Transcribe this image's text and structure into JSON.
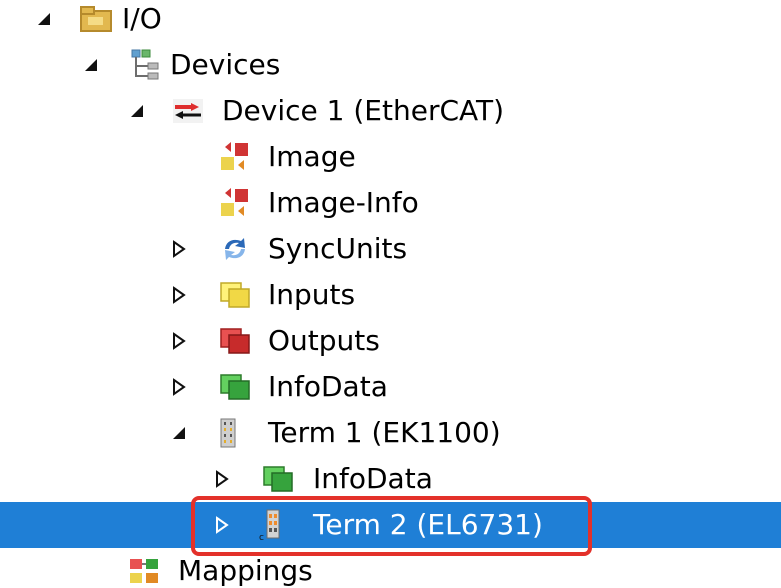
{
  "tree": {
    "io": {
      "label": "I/O"
    },
    "devices": {
      "label": "Devices"
    },
    "device1": {
      "label": "Device 1 (EtherCAT)"
    },
    "image": {
      "label": "Image"
    },
    "imageInfo": {
      "label": "Image-Info"
    },
    "syncUnits": {
      "label": "SyncUnits"
    },
    "inputs": {
      "label": "Inputs"
    },
    "outputs": {
      "label": "Outputs"
    },
    "infoData": {
      "label": "InfoData"
    },
    "term1": {
      "label": "Term 1 (EK1100)"
    },
    "term1InfoData": {
      "label": "InfoData"
    },
    "term2": {
      "label": "Term 2 (EL6731)"
    },
    "mappings": {
      "label": "Mappings"
    }
  },
  "colors": {
    "selection": "#1f7fd6",
    "highlight": "#e3312a",
    "inputs_icon": "#e5d84b",
    "outputs_icon": "#c72b2b",
    "infodata_icon": "#36a33d"
  },
  "icons": {
    "io": "folder-icon",
    "devices": "devices-icon",
    "device1": "ethercat-device-icon",
    "image": "image-icon",
    "imageInfo": "image-info-icon",
    "syncUnits": "sync-units-icon",
    "inputs": "inputs-icon",
    "outputs": "outputs-icon",
    "infoData": "infodata-icon",
    "term1": "terminal-ek1100-icon",
    "term1InfoData": "infodata-icon",
    "term2": "terminal-el6731-icon",
    "mappings": "mappings-icon"
  }
}
